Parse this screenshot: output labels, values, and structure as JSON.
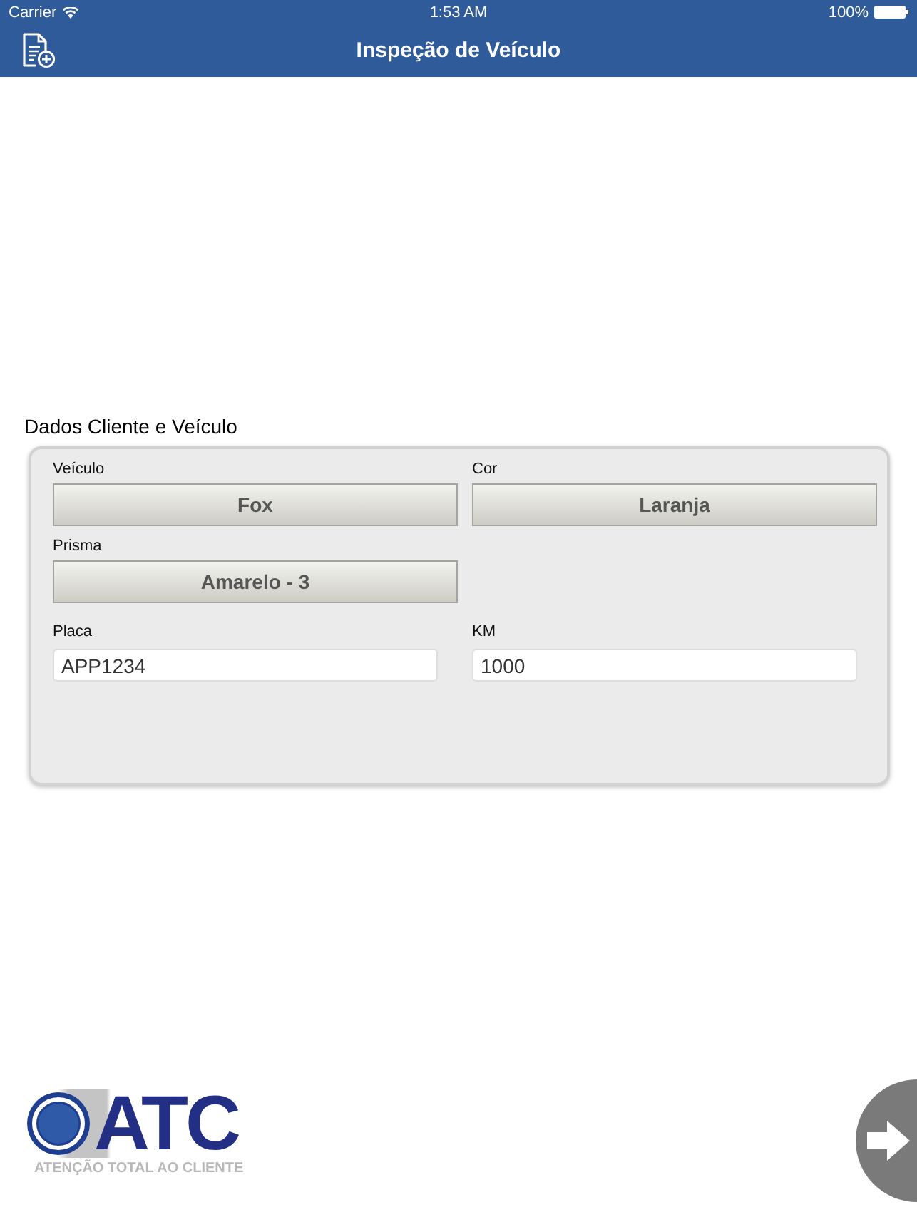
{
  "status_bar": {
    "carrier": "Carrier",
    "time": "1:53 AM",
    "battery": "100%"
  },
  "nav_bar": {
    "title": "Inspeção de Veículo"
  },
  "section": {
    "title": "Dados Cliente e Veículo"
  },
  "fields": [
    {
      "kind": "picker",
      "label": "Veículo",
      "value": "Fox"
    },
    {
      "kind": "picker",
      "label": "Cor",
      "value": "Laranja"
    },
    {
      "kind": "picker",
      "label": "Prisma",
      "value": "Amarelo - 3"
    },
    {
      "kind": "spacer"
    },
    {
      "kind": "text",
      "label": "Placa",
      "value": "APP1234"
    },
    {
      "kind": "text",
      "label": "KM",
      "value": "1000"
    }
  ],
  "logo": {
    "name": "ATC",
    "tagline": "ATENÇÃO TOTAL AO CLIENTE"
  }
}
